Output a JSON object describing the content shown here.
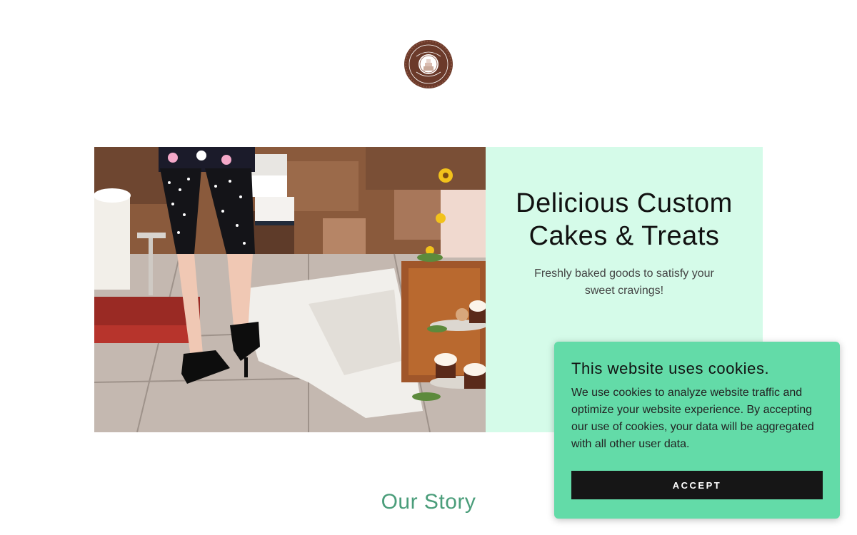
{
  "logo": {
    "icon": "cake-logo-icon",
    "colors": {
      "ring": "#6b3a2a",
      "inner": "#ffffff"
    }
  },
  "hero": {
    "title": "Delicious Custom Cakes & Treats",
    "subtitle": "Freshly baked goods to satisfy your sweet cravings!",
    "photo_icon": "hero-photo",
    "panel_color": "#d5fbe9"
  },
  "story": {
    "heading": "Our Story",
    "color": "#4a9d7a"
  },
  "cookie_banner": {
    "title": "This website uses cookies.",
    "body": "We use cookies to analyze website traffic and optimize your website experience. By accepting our use of cookies, your data will be aggregated with all other user data.",
    "accept_label": "ACCEPT",
    "background": "#63dba8",
    "button_color": "#161616"
  }
}
